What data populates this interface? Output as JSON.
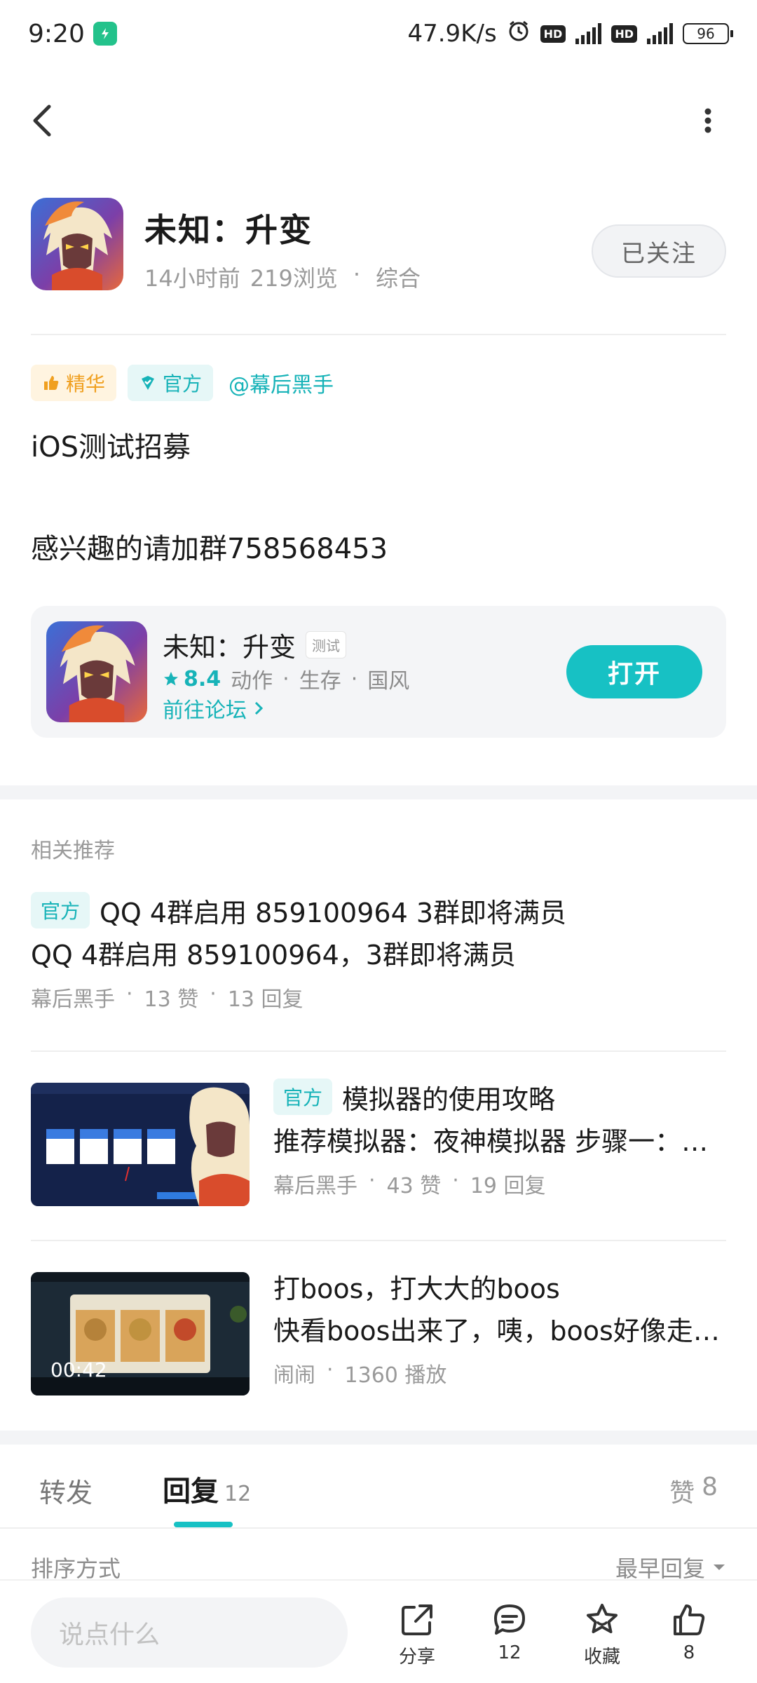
{
  "status": {
    "time": "9:20",
    "speed": "47.9K/s",
    "battery": "96"
  },
  "header": {
    "title": "未知：升变",
    "time_ago": "14小时前",
    "views": "219浏览",
    "category": "综合",
    "follow_label": "已关注"
  },
  "tags": {
    "jinghua": "精华",
    "official": "官方",
    "mention": "@幕后黑手"
  },
  "post": {
    "line1": "iOS测试招募",
    "line2": "感兴趣的请加群758568453"
  },
  "game_card": {
    "name": "未知：升变",
    "badge": "测试",
    "rating": "8.4",
    "genres": [
      "动作",
      "生存",
      "国风"
    ],
    "forum_link": "前往论坛",
    "open_label": "打开"
  },
  "recommend": {
    "title": "相关推荐",
    "items": [
      {
        "tag": "官方",
        "title": "QQ 4群启用  859100964  3群即将满员",
        "summary": "QQ 4群启用  859100964，3群即将满员",
        "author": "幕后黑手",
        "likes": "13 赞",
        "replies": "13 回复"
      },
      {
        "tag": "官方",
        "title": "模拟器的使用攻略",
        "summary": "推荐模拟器：夜神模拟器 步骤一：…",
        "author": "幕后黑手",
        "likes": "43 赞",
        "replies": "19 回复"
      },
      {
        "title": "打boos，打大大的boos",
        "summary": "快看boos出来了，咦，boos好像走…",
        "author": "闹闹",
        "plays": "1360 播放",
        "duration": "00:42"
      }
    ]
  },
  "comment_tabs": {
    "forward": "转发",
    "reply": "回复",
    "reply_count": "12",
    "like": "赞",
    "like_count": "8"
  },
  "sort": {
    "label": "排序方式",
    "value": "最早回复"
  },
  "bottom": {
    "input_placeholder": "说点什么",
    "share": "分享",
    "comment_count": "12",
    "favorite": "收藏",
    "like_count": "8"
  },
  "colors": {
    "accent": "#17c1c4",
    "accent_text": "#17b3b8",
    "jinghua": "#f0a020"
  }
}
